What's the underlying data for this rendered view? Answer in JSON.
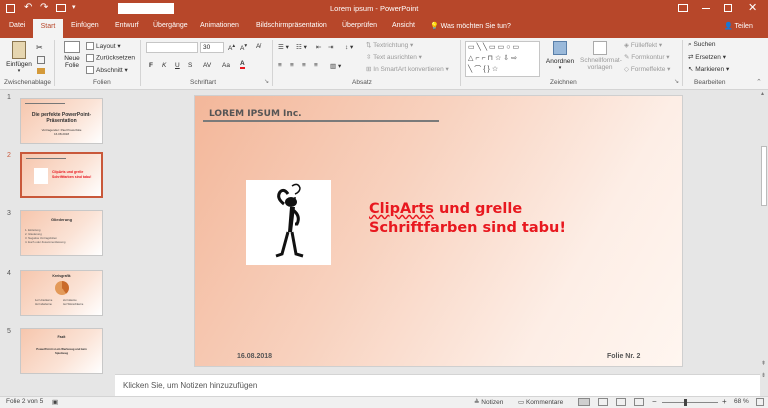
{
  "titlebar": {
    "title": "Lorem ipsum  -  PowerPoint",
    "login_icon": "user-icon"
  },
  "tabs": [
    "Datei",
    "Start",
    "Einfügen",
    "Entwurf",
    "Übergänge",
    "Animationen",
    "Bildschirmpräsentation",
    "Überprüfen",
    "Ansicht"
  ],
  "tellme": "Was möchten Sie tun?",
  "share": "Teilen",
  "groups": {
    "clipboard": "Zwischenablage",
    "slides": "Folien",
    "font": "Schriftart",
    "paragraph": "Absatz",
    "drawing": "Zeichnen",
    "editing": "Bearbeiten"
  },
  "clipboard": {
    "paste": "Einfügen"
  },
  "slides_grp": {
    "new_slide_1": "Neue",
    "new_slide_2": "Folie",
    "layout": "Layout",
    "reset": "Zurücksetzen",
    "section": "Abschnitt"
  },
  "font": {
    "size": "30",
    "bold": "F",
    "italic": "K",
    "underline": "U",
    "strike": "S",
    "spacing": "AV",
    "case": "Aa"
  },
  "paragraph": {
    "text_direction": "Textrichtung",
    "align_text": "Text ausrichten",
    "smartart": "In SmartArt konvertieren"
  },
  "drawing": {
    "arrange": "Anordnen",
    "quick_styles_1": "Schnellformat-",
    "quick_styles_2": "vorlagen",
    "fill": "Fülleffekt",
    "outline": "Formkontur",
    "effects": "Formeffekte"
  },
  "editing": {
    "find": "Suchen",
    "replace": "Ersetzen",
    "select": "Markieren"
  },
  "thumbnails": [
    {
      "num": "1",
      "title": "Die perfekte PowerPoint-Präsentation",
      "sub": "Vortragender: Paul Powerfolie 16.08.2018"
    },
    {
      "num": "2",
      "title": "ClipArts und grelle Schriftfarben sind tabu!"
    },
    {
      "num": "3",
      "title": "Gliederung",
      "items": [
        "1. Einleitung",
        "2. Gliederung",
        "3. Negative Vortragsfolien",
        "4. Euch oder Zusammenfassung"
      ]
    },
    {
      "num": "4",
      "title": "Kreisgrafik",
      "items": [
        "1er Unterkerne",
        "2er Istkerne",
        "3er Inderkerne",
        "4er Wünschkerne"
      ]
    },
    {
      "num": "5",
      "title": "Fazit",
      "sub": "PowerPoint ist ein Werkzeug und kein Spielzeug"
    }
  ],
  "slide": {
    "company": "LOREM IPSUM Inc.",
    "headline_1": "ClipArts",
    "headline_2": " und grelle",
    "headline_3": "Schriftfarben sind tabu!",
    "date": "16.08.2018",
    "slide_no": "Folie Nr. 2"
  },
  "notes_placeholder": "Klicken Sie, um Notizen hinzuzufügen",
  "status": {
    "slide_of": "Folie 2 von 5",
    "notes": "Notizen",
    "comments": "Kommentare",
    "zoom": "68 %"
  },
  "colors": {
    "accent": "#b7472a",
    "headline": "#e8181f"
  }
}
